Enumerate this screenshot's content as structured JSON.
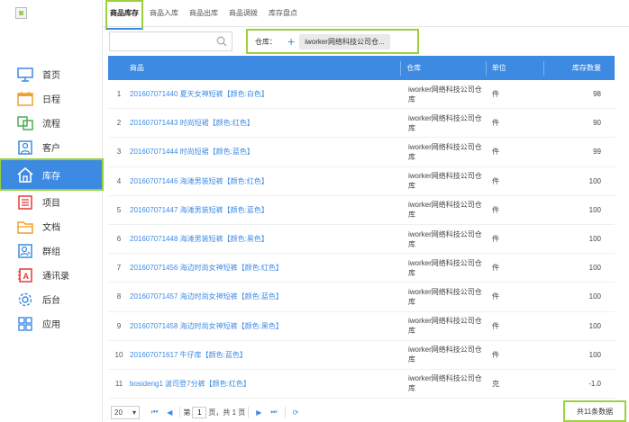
{
  "colors": {
    "accent": "#3d8ae3",
    "highlight": "#9bd13b"
  },
  "sidebar": {
    "items": [
      {
        "label": "首页",
        "icon": "monitor-icon"
      },
      {
        "label": "日程",
        "icon": "calendar-icon"
      },
      {
        "label": "流程",
        "icon": "flow-icon"
      },
      {
        "label": "客户",
        "icon": "customer-icon"
      },
      {
        "label": "库存",
        "icon": "home-icon"
      },
      {
        "label": "项目",
        "icon": "project-icon"
      },
      {
        "label": "文档",
        "icon": "folder-icon"
      },
      {
        "label": "群组",
        "icon": "group-icon"
      },
      {
        "label": "通讯录",
        "icon": "contacts-icon"
      },
      {
        "label": "后台",
        "icon": "gear-icon"
      },
      {
        "label": "应用",
        "icon": "apps-icon"
      }
    ]
  },
  "tabs": [
    {
      "label": "商品库存"
    },
    {
      "label": "商品入库"
    },
    {
      "label": "商品出库"
    },
    {
      "label": "商品调拨"
    },
    {
      "label": "库存盘点"
    }
  ],
  "search": {
    "value": "",
    "placeholder": ""
  },
  "filter": {
    "label": "仓库：",
    "plus": "+",
    "chip": "iworker网络科技公司仓..."
  },
  "table": {
    "headers": {
      "name": "商品",
      "warehouse": "仓库",
      "unit": "单位",
      "qty": "库存数量"
    },
    "rows": [
      {
        "idx": "1",
        "name": "201607071440 夏天女神短裤【颜色:白色】",
        "warehouse": "iworker网络科技公司仓库",
        "unit": "件",
        "qty": "98"
      },
      {
        "idx": "2",
        "name": "201607071443 时尚短裙【颜色:红色】",
        "warehouse": "iworker网络科技公司仓库",
        "unit": "件",
        "qty": "90"
      },
      {
        "idx": "3",
        "name": "201607071444 时尚短裙【颜色:蓝色】",
        "warehouse": "iworker网络科技公司仓库",
        "unit": "件",
        "qty": "99"
      },
      {
        "idx": "4",
        "name": "201607071446 海滩男装短裤【颜色:红色】",
        "warehouse": "iworker网络科技公司仓库",
        "unit": "件",
        "qty": "100"
      },
      {
        "idx": "5",
        "name": "201607071447 海滩男装短裤【颜色:蓝色】",
        "warehouse": "iworker网络科技公司仓库",
        "unit": "件",
        "qty": "100"
      },
      {
        "idx": "6",
        "name": "201607071448 海滩男装短裤【颜色:黑色】",
        "warehouse": "iworker网络科技公司仓库",
        "unit": "件",
        "qty": "100"
      },
      {
        "idx": "7",
        "name": "201607071456 海边时尚女神短裤【颜色:红色】",
        "warehouse": "iworker网络科技公司仓库",
        "unit": "件",
        "qty": "100"
      },
      {
        "idx": "8",
        "name": "201607071457 海边时尚女神短裤【颜色:蓝色】",
        "warehouse": "iworker网络科技公司仓库",
        "unit": "件",
        "qty": "100"
      },
      {
        "idx": "9",
        "name": "201607071458 海边时尚女神短裤【颜色:黑色】",
        "warehouse": "iworker网络科技公司仓库",
        "unit": "件",
        "qty": "100"
      },
      {
        "idx": "10",
        "name": "201607071617 牛仔库【颜色:蓝色】",
        "warehouse": "iworker网络科技公司仓库",
        "unit": "件",
        "qty": "100"
      },
      {
        "idx": "11",
        "name": "bosideng1 波司登7分裤【颜色:红色】",
        "warehouse": "iworker网络科技公司仓库",
        "unit": "克",
        "qty": "-1.0"
      }
    ]
  },
  "pager": {
    "size": "20",
    "page_prefix": "第",
    "page_value": "1",
    "page_suffix": "页，共 1 页",
    "total": "共11条数据"
  }
}
